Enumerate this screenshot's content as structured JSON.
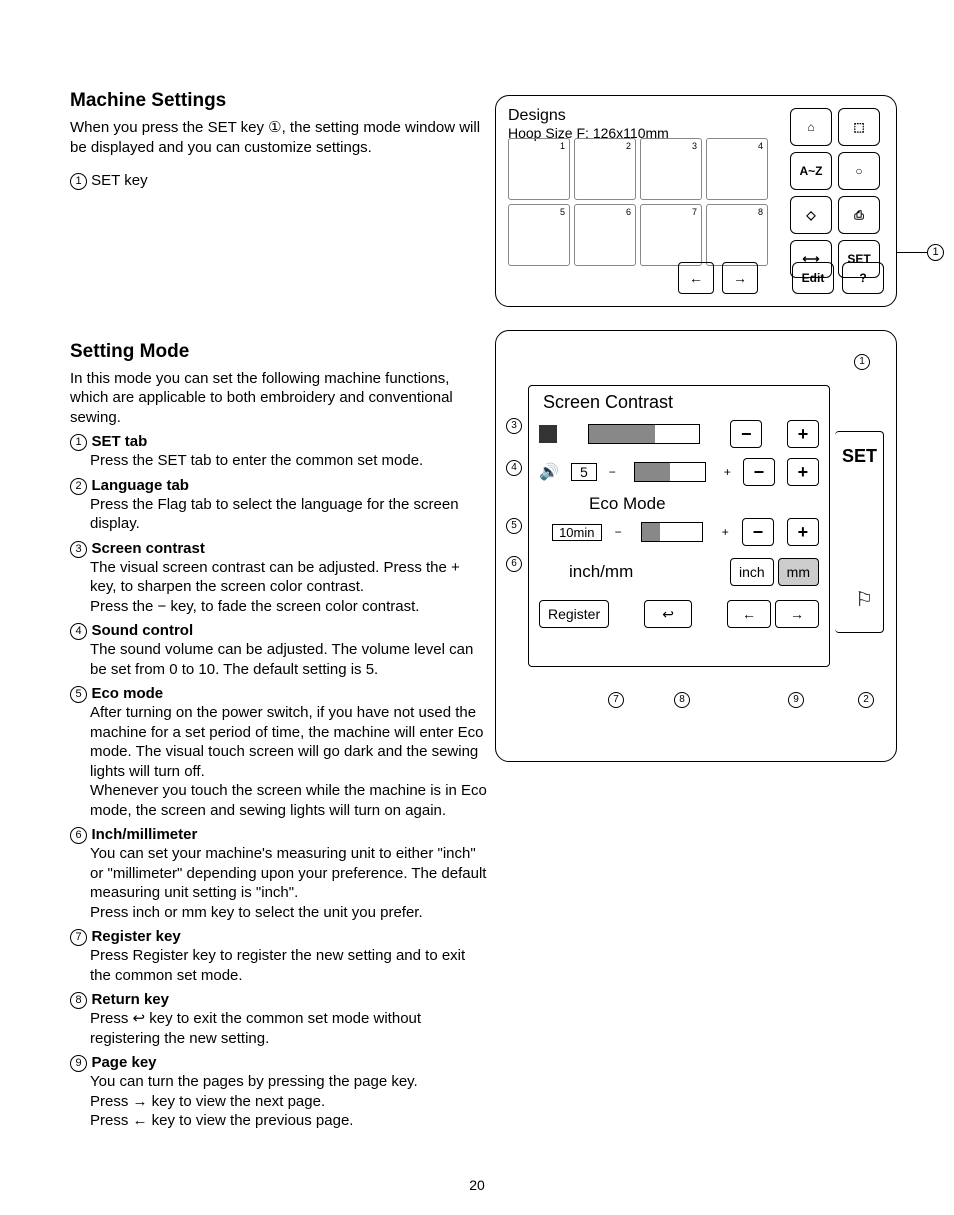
{
  "section1": {
    "heading": "Machine Settings",
    "intro": "When you press the SET key ①, the setting mode window will be displayed and you can customize settings.",
    "bullet1_num": "1",
    "bullet1": "SET key"
  },
  "fig1": {
    "title1": "Designs",
    "title2": "Hoop Size F: 126x110mm",
    "cells": [
      "1",
      "2",
      "3",
      "4",
      "5",
      "6",
      "7",
      "8"
    ],
    "right": [
      "A~Z",
      "SET",
      "Edit",
      "?"
    ],
    "nav_prev": "←",
    "nav_next": "→",
    "callout1": "1"
  },
  "section2": {
    "heading": "Setting Mode",
    "intro": "In this mode you can set the following machine functions, which are applicable to both embroidery and conventional sewing."
  },
  "items": [
    {
      "num": "1",
      "title": "SET tab",
      "desc": "Press the SET tab to enter the common set mode."
    },
    {
      "num": "2",
      "title": "Language tab",
      "desc": "Press the Flag tab to select the language for the screen display."
    },
    {
      "num": "3",
      "title": "Screen contrast",
      "desc": "The visual screen contrast can be adjusted. Press the  +  key, to sharpen the screen color contrast.\nPress the  −  key, to fade the screen color contrast."
    },
    {
      "num": "4",
      "title": "Sound control",
      "desc": "The sound volume can be adjusted. The volume level can be set from 0 to 10. The default setting is 5."
    },
    {
      "num": "5",
      "title": "Eco mode",
      "desc": "After turning on the power switch, if you have not used the machine for a set period of time, the machine will enter Eco mode. The visual touch screen will go dark and the sewing lights will turn off.\nWhenever you touch the screen while the machine is in Eco mode, the screen and sewing lights will turn on again."
    },
    {
      "num": "6",
      "title": "Inch/millimeter",
      "desc": "You can set your machine's measuring unit to either \"inch\" or \"millimeter\" depending upon your preference. The default measuring unit setting is \"inch\".\nPress inch or mm key to select the unit you prefer."
    },
    {
      "num": "7",
      "title": "Register key",
      "desc": "Press Register key to register the new setting and to exit the common set mode."
    },
    {
      "num": "8",
      "title": "Return key",
      "desc": "Press ↩ key to exit the common set mode without registering the new setting."
    },
    {
      "num": "9",
      "title": "Page key",
      "desc": "You can turn the pages by pressing the page key.\nPress → key to view the next page.\nPress ← key to view the previous page."
    }
  ],
  "fig2": {
    "heading": "Screen Contrast",
    "sound_value": "5",
    "eco_heading": "Eco Mode",
    "eco_value": "10min",
    "unit_heading": "inch/mm",
    "unit_inch": "inch",
    "unit_mm": "mm",
    "register": "Register",
    "tab": "SET",
    "minus": "−",
    "plus": "+",
    "callouts": {
      "c1": "1",
      "c2": "2",
      "c3": "3",
      "c4": "4",
      "c5": "5",
      "c6": "6",
      "c7": "7",
      "c8": "8",
      "c9": "9"
    }
  },
  "pagenum": "20"
}
